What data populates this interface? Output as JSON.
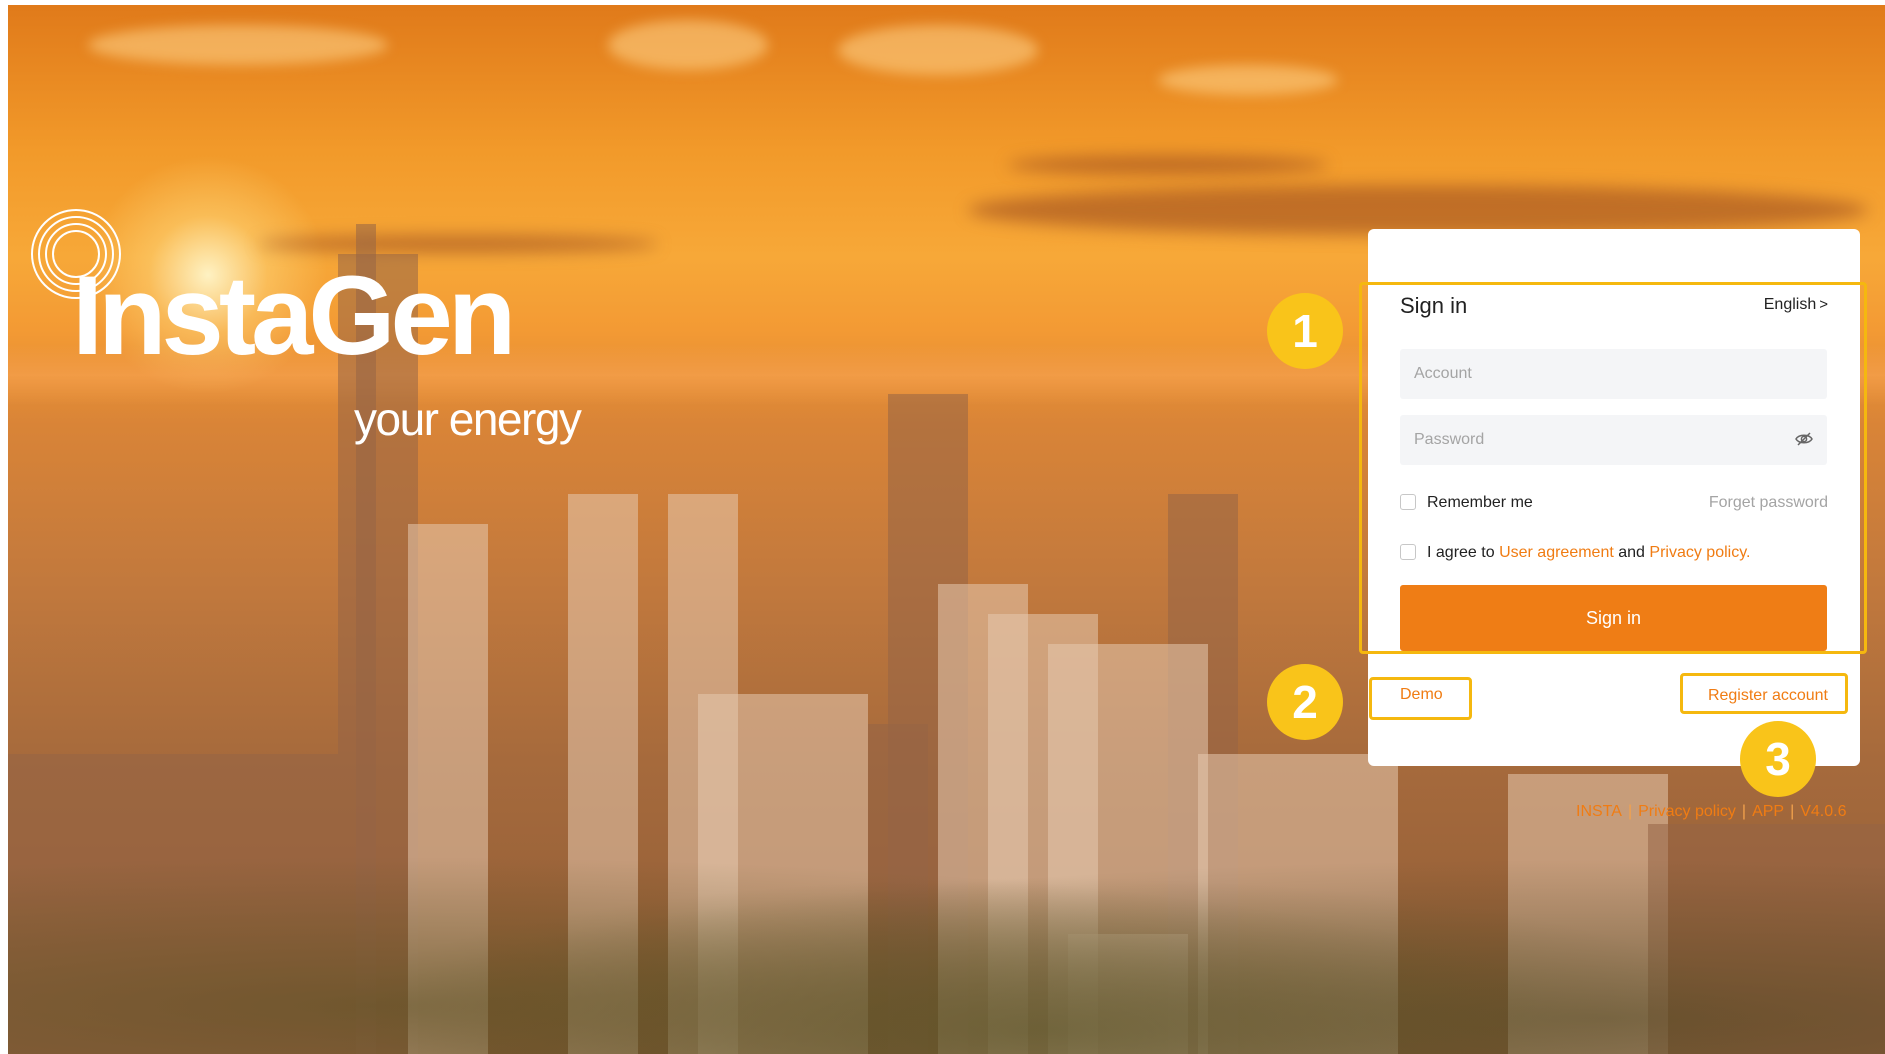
{
  "brand": {
    "name": "InstaGen",
    "tagline": "your energy"
  },
  "login": {
    "title": "Sign in",
    "language": "English",
    "account_placeholder": "Account",
    "password_placeholder": "Password",
    "remember_label": "Remember me",
    "forget_label": "Forget password",
    "agree_prefix": "I agree to",
    "user_agreement": "User agreement",
    "agree_and": "and",
    "privacy_policy": "Privacy policy",
    "agree_suffix": ".",
    "sign_in_button": "Sign in",
    "demo_label": "Demo",
    "register_label": "Register account"
  },
  "annotations": {
    "badge1": "1",
    "badge2": "2",
    "badge3": "3"
  },
  "footer": {
    "insta": "INSTA",
    "privacy": "Privacy policy",
    "app": "APP",
    "version": "V4.0.6"
  },
  "colors": {
    "accent": "#ef7d15",
    "annotation": "#f9c41a"
  }
}
